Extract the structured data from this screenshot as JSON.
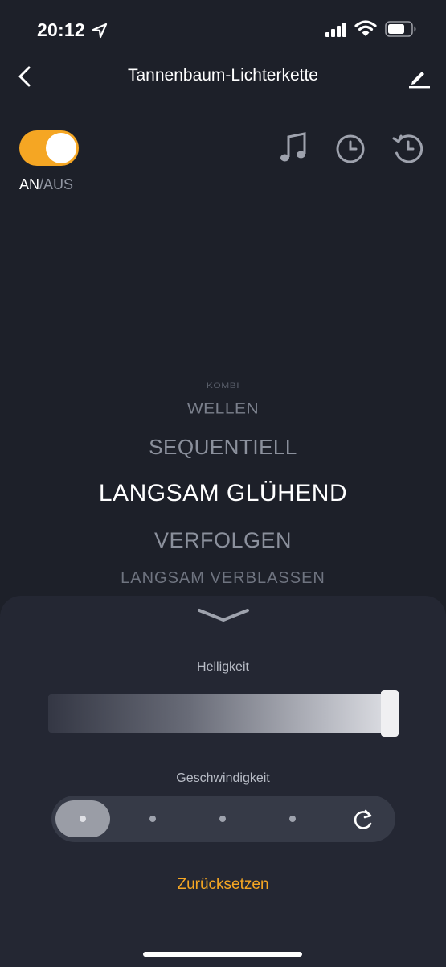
{
  "status": {
    "time": "20:12"
  },
  "nav": {
    "title": "Tannenbaum-Lichterkette"
  },
  "power": {
    "on_label": "AN",
    "separator": "/",
    "off_label": "AUS",
    "state": "on"
  },
  "modes": {
    "items": [
      "KOMBI",
      "WELLEN",
      "SEQUENTIELL",
      "LANGSAM GLÜHEND",
      "VERFOLGEN",
      "LANGSAM VERBLASSEN"
    ],
    "selected": "LANGSAM GLÜHEND"
  },
  "panel": {
    "brightness_label": "Helligkeit",
    "brightness_value": 1.0,
    "speed_label": "Geschwindigkeit",
    "speed_selected_index": 0,
    "reset_label": "Zurücksetzen"
  },
  "colors": {
    "accent": "#f5a623",
    "background": "#1d2029",
    "sheet": "#242733"
  }
}
